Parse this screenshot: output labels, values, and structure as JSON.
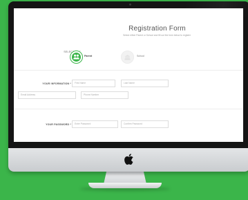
{
  "form": {
    "title": "Registration Form",
    "subtitle": "Select either Parent or School and fill out the form below to register",
    "select_label": "SELECT ONE",
    "options": [
      {
        "label": "Parent",
        "selected": true,
        "icon": "parent-icon"
      },
      {
        "label": "School",
        "selected": false,
        "icon": "school-icon"
      }
    ],
    "your_information_label": "YOUR INFORMATION *",
    "fields": {
      "first_name": {
        "placeholder": "First Name"
      },
      "last_name": {
        "placeholder": "Last Name"
      },
      "email": {
        "placeholder": "Email Address"
      },
      "phone": {
        "placeholder": "Phone Number"
      },
      "password": {
        "placeholder": "Enter Password"
      },
      "confirm_password": {
        "placeholder": "Confirm Password"
      }
    },
    "your_password_label": "YOUR PASSWORD *"
  },
  "colors": {
    "accent": "#3bb54a",
    "background": "#3bb54a",
    "bezel": "#151515",
    "chin": "#d9dcde"
  },
  "device": {
    "logo_icon": "apple-logo-icon"
  }
}
